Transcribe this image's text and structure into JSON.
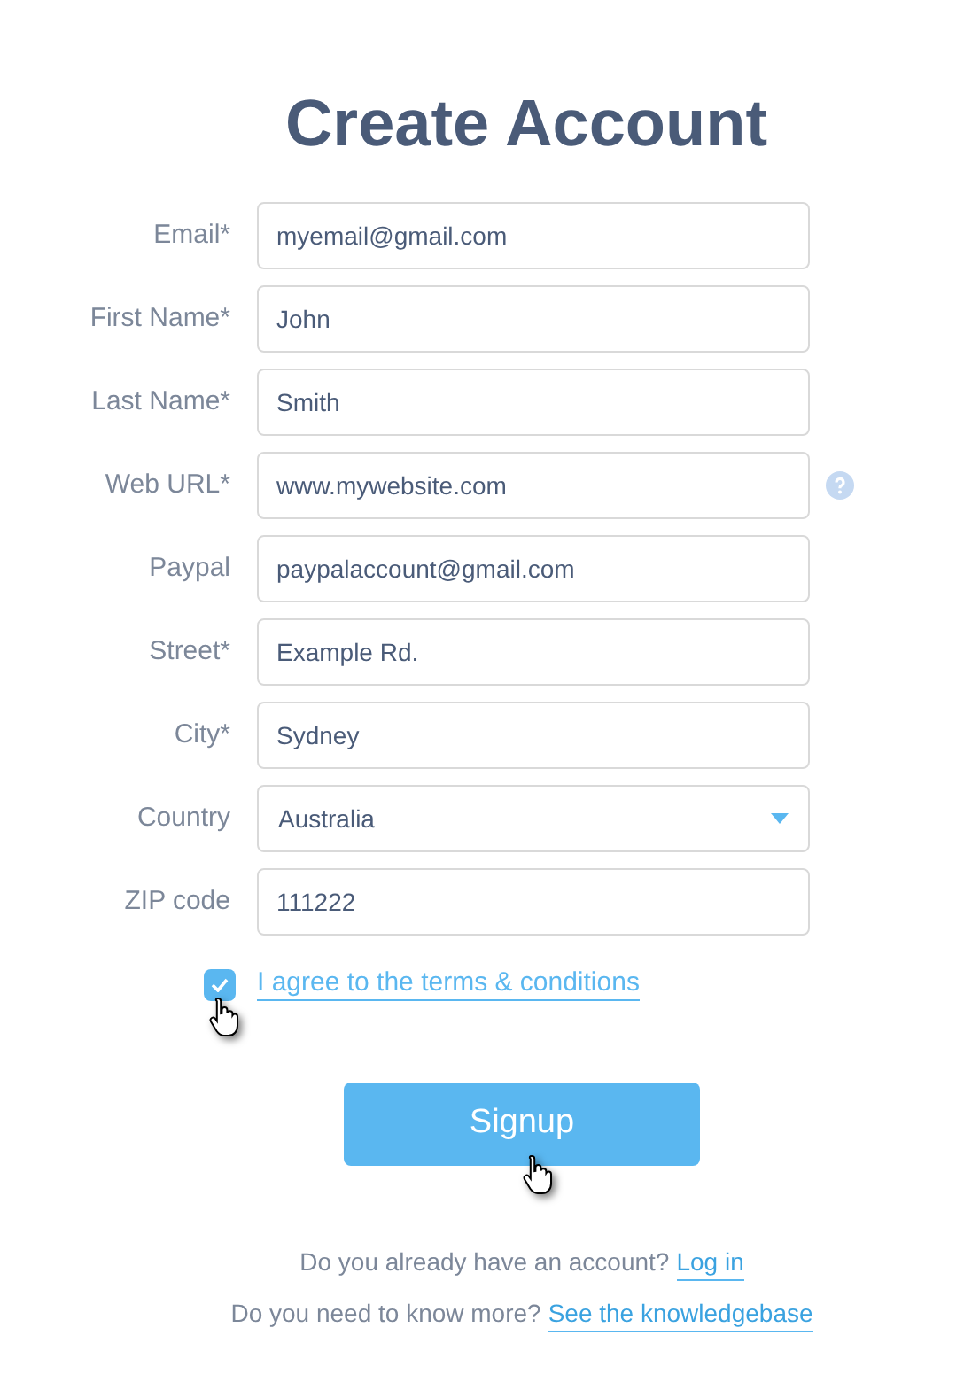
{
  "title": "Create Account",
  "fields": [
    {
      "label": "Email*",
      "value": "myemail@gmail.com",
      "kind": "text",
      "help": false
    },
    {
      "label": "First Name*",
      "value": "John",
      "kind": "text",
      "help": false
    },
    {
      "label": "Last Name*",
      "value": "Smith",
      "kind": "text",
      "help": false
    },
    {
      "label": "Web URL*",
      "value": "www.mywebsite.com",
      "kind": "text",
      "help": true
    },
    {
      "label": "Paypal",
      "value": "paypalaccount@gmail.com",
      "kind": "text",
      "help": false
    },
    {
      "label": "Street*",
      "value": "Example Rd.",
      "kind": "text",
      "help": false
    },
    {
      "label": "City*",
      "value": "Sydney",
      "kind": "text",
      "help": false
    },
    {
      "label": "Country",
      "value": "Australia",
      "kind": "select",
      "help": false
    },
    {
      "label": "ZIP code",
      "value": "111222",
      "kind": "text",
      "help": false
    }
  ],
  "terms": {
    "label": "I agree to the terms & conditions",
    "checked": true
  },
  "submit": "Signup",
  "footer": [
    {
      "text": "Do you already have an account?",
      "link": "Log in"
    },
    {
      "text": "Do you need to know more?",
      "link": "See the knowledgebase"
    }
  ]
}
